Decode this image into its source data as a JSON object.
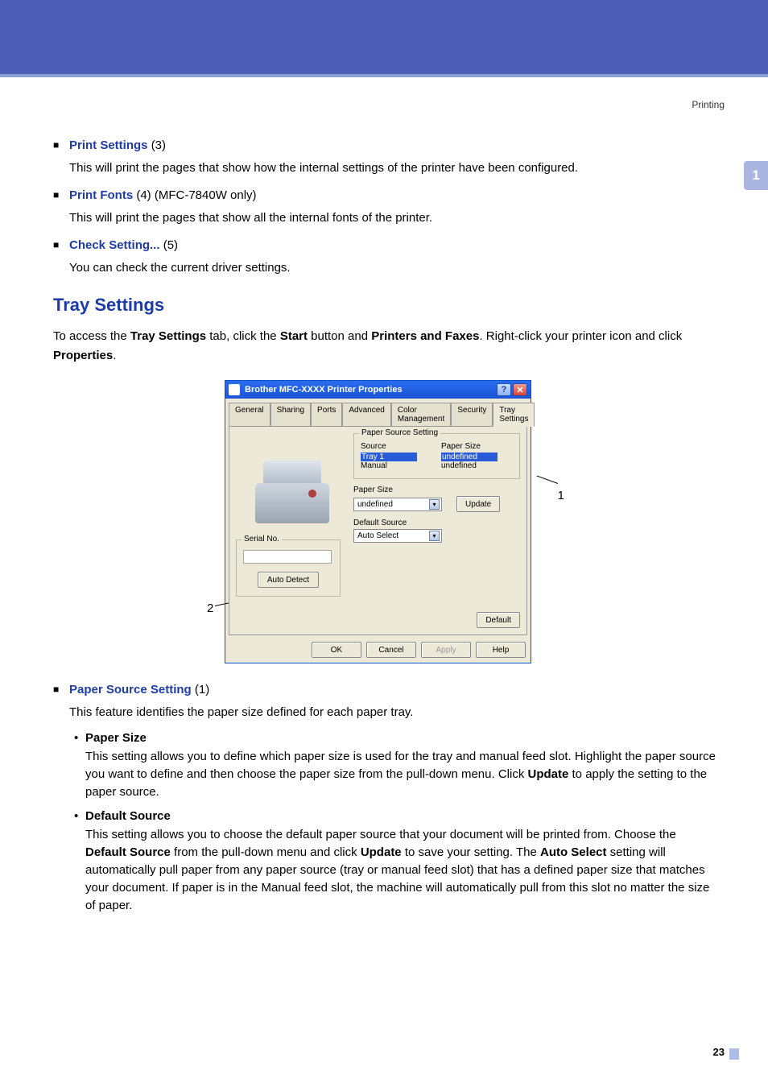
{
  "header_label": "Printing",
  "side_tab": "1",
  "items": [
    {
      "title": "Print Settings",
      "num": "(3)",
      "body": "This will print the pages that show how the internal settings of the printer have been configured."
    },
    {
      "title": "Print Fonts",
      "num": "(4) (MFC-7840W only)",
      "body": "This will print the pages that show all the internal fonts of the printer."
    },
    {
      "title": "Check Setting...",
      "num": "(5)",
      "body": "You can check the current driver settings."
    }
  ],
  "heading": "Tray Settings",
  "access_para": {
    "a": "To access the ",
    "b": "Tray Settings",
    "c": " tab, click the ",
    "d": "Start",
    "e": " button and ",
    "f": "Printers and Faxes",
    "g": ". Right-click your printer icon and click ",
    "h": "Properties",
    "i": "."
  },
  "dialog": {
    "title": "Brother MFC-XXXX Printer Properties",
    "tabs": [
      "General",
      "Sharing",
      "Ports",
      "Advanced",
      "Color Management",
      "Security",
      "Tray Settings"
    ],
    "active_tab": 6,
    "pss_label": "Paper Source Setting",
    "source_hdr": "Source",
    "size_hdr": "Paper Size",
    "rows": [
      {
        "src": "Tray 1",
        "size": "undefined",
        "selected": true
      },
      {
        "src": "Manual",
        "size": "undefined",
        "selected": false
      }
    ],
    "paper_size_label": "Paper Size",
    "paper_size_value": "undefined",
    "update_btn": "Update",
    "default_source_label": "Default Source",
    "default_source_value": "Auto Select",
    "serial_label": "Serial No.",
    "auto_detect_btn": "Auto Detect",
    "default_btn": "Default",
    "buttons": {
      "ok": "OK",
      "cancel": "Cancel",
      "apply": "Apply",
      "help": "Help"
    }
  },
  "callouts": {
    "one": "1",
    "two": "2"
  },
  "paper_source": {
    "title": "Paper Source Setting",
    "num": "(1)",
    "intro": "This feature identifies the paper size defined for each paper tray.",
    "sub1_title": "Paper Size",
    "sub1_body_a": "This setting allows you to define which paper size is used for the tray and manual feed slot. Highlight the paper source you want to define and then choose the paper size from the pull-down menu. Click ",
    "sub1_body_b": "Update",
    "sub1_body_c": " to apply the setting to the paper source.",
    "sub2_title": "Default Source",
    "sub2_body_a": "This setting allows you to choose the default paper source that  your document will be printed from. Choose the ",
    "sub2_body_b": "Default Source",
    "sub2_body_c": " from the pull-down menu and click ",
    "sub2_body_d": "Update",
    "sub2_body_e": " to save your setting. The ",
    "sub2_body_f": "Auto Select",
    "sub2_body_g": " setting will automatically pull paper from any paper source (tray or manual feed slot) that has a defined paper size that matches your document.  If paper is in the Manual feed slot, the machine will automatically pull from this slot no matter the size of paper."
  },
  "page_number": "23"
}
